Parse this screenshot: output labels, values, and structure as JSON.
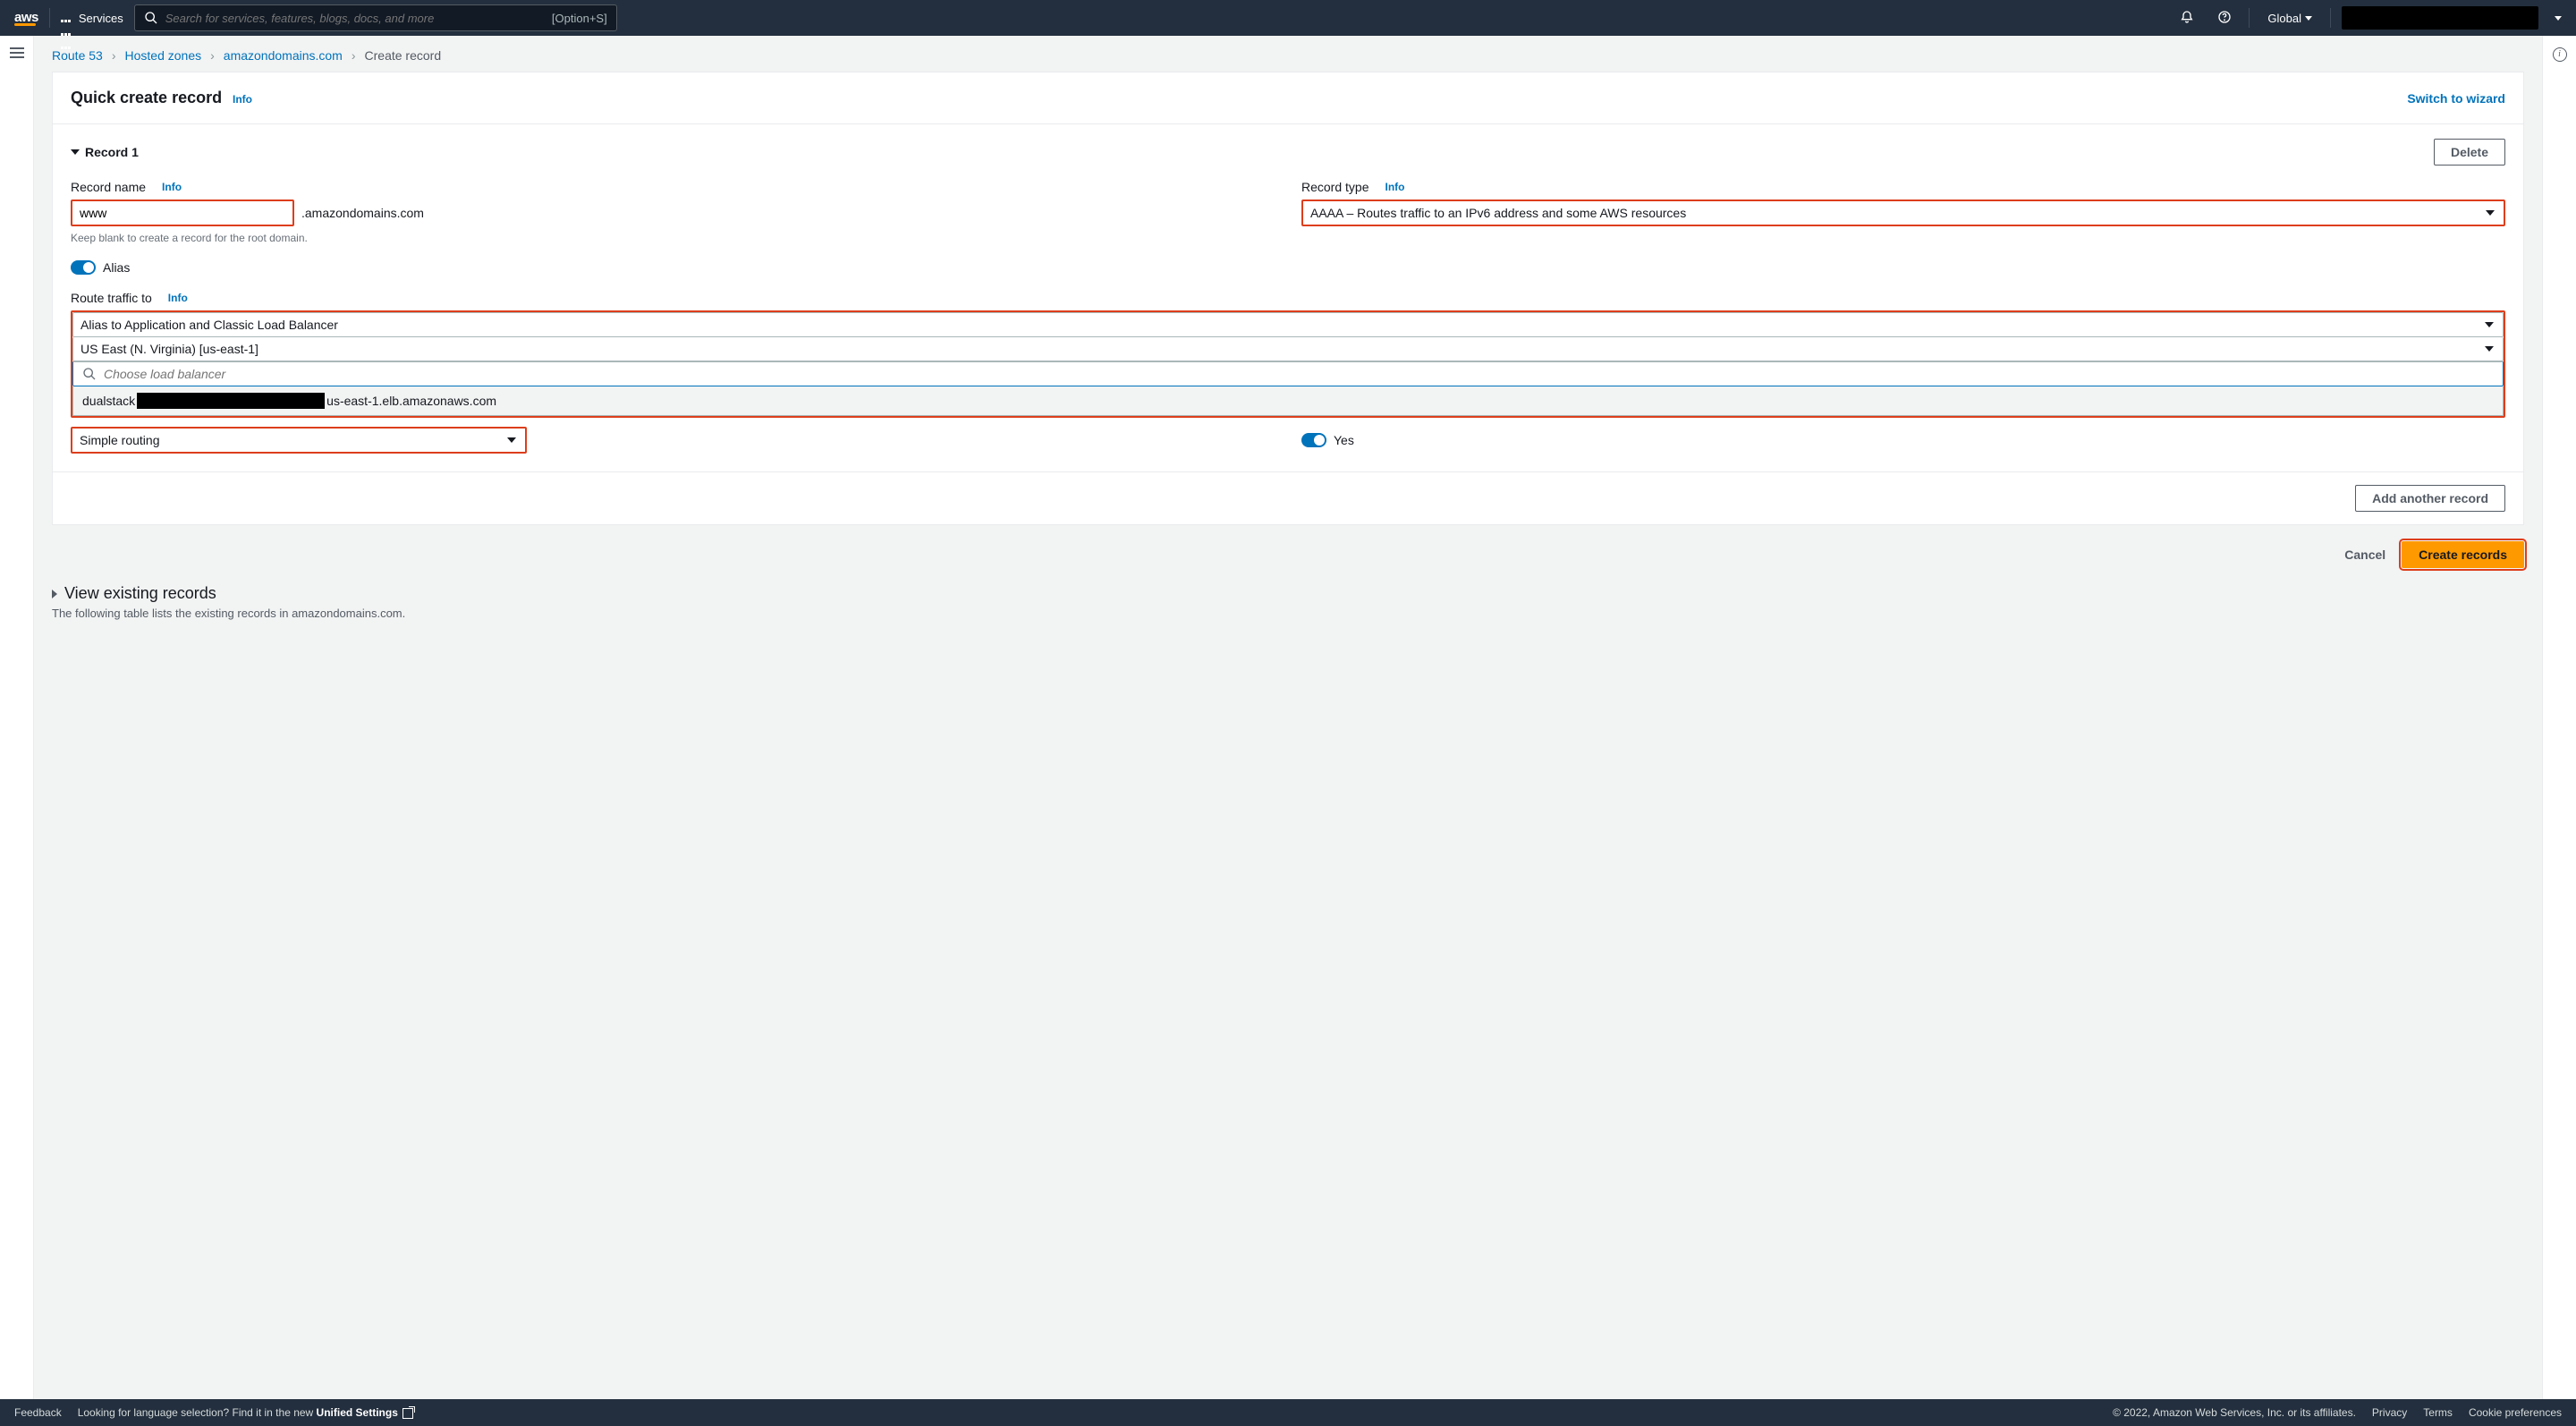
{
  "topnav": {
    "logo": "aws",
    "services": "Services",
    "search_placeholder": "Search for services, features, blogs, docs, and more",
    "shortcut": "[Option+S]",
    "region": "Global"
  },
  "breadcrumb": {
    "items": [
      "Route 53",
      "Hosted zones",
      "amazondomains.com"
    ],
    "current": "Create record"
  },
  "panel": {
    "title": "Quick create record",
    "info": "Info",
    "switch": "Switch to wizard"
  },
  "record": {
    "header": "Record 1",
    "delete": "Delete",
    "name_label": "Record name",
    "name_value": "www",
    "name_suffix": ".amazondomains.com",
    "name_hint": "Keep blank to create a record for the root domain.",
    "type_label": "Record type",
    "type_value": "AAAA – Routes traffic to an IPv6 address and some AWS resources",
    "alias_label": "Alias",
    "route_label": "Route traffic to",
    "alias_target": "Alias to Application and Classic Load Balancer",
    "alias_region": "US East (N. Virginia) [us-east-1]",
    "lb_placeholder": "Choose load balancer",
    "lb_option_prefix": "dualstack",
    "lb_option_suffix": "us-east-1.elb.amazonaws.com",
    "routing_value": "Simple routing",
    "eval_label": "Yes"
  },
  "footer_panel": {
    "add": "Add another record"
  },
  "actions": {
    "cancel": "Cancel",
    "create": "Create records"
  },
  "existing": {
    "title": "View existing records",
    "desc": "The following table lists the existing records in amazondomains.com."
  },
  "footer": {
    "feedback": "Feedback",
    "lang_q": "Looking for language selection? Find it in the new ",
    "lang_link": "Unified Settings",
    "copyright": "© 2022, Amazon Web Services, Inc. or its affiliates.",
    "privacy": "Privacy",
    "terms": "Terms",
    "cookies": "Cookie preferences"
  }
}
